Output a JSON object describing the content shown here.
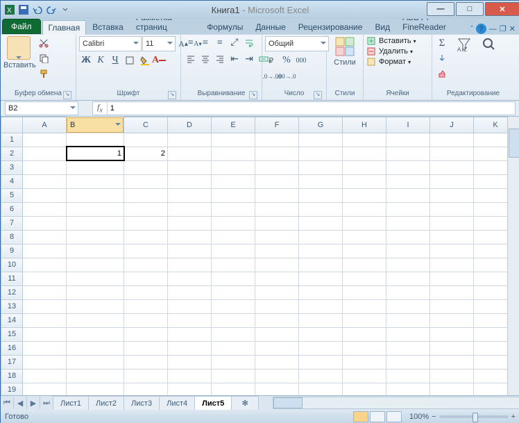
{
  "title": {
    "doc": "Книга1",
    "app": "Microsoft Excel",
    "sep": " - "
  },
  "tabs": {
    "file": "Файл",
    "home": "Главная",
    "insert": "Вставка",
    "layout": "Разметка страниц",
    "formulas": "Формулы",
    "data": "Данные",
    "review": "Рецензирование",
    "view": "Вид",
    "abbyy": "ABBYY FineReader"
  },
  "ribbon": {
    "clipboard": {
      "label": "Буфер обмена",
      "paste": "Вставить"
    },
    "font": {
      "label": "Шрифт",
      "name": "Calibri",
      "size": "11",
      "bold": "Ж",
      "italic": "К",
      "underline": "Ч"
    },
    "align": {
      "label": "Выравнивание"
    },
    "number": {
      "label": "Число",
      "format": "Общий"
    },
    "styles": {
      "label": "Стили",
      "btn": "Стили"
    },
    "cells": {
      "label": "Ячейки",
      "insert": "Вставить",
      "delete": "Удалить",
      "format": "Формат"
    },
    "edit": {
      "label": "Редактирование"
    }
  },
  "formula": {
    "cellref": "B2",
    "value": "1"
  },
  "columns": [
    "A",
    "B",
    "C",
    "D",
    "E",
    "F",
    "G",
    "H",
    "I",
    "J",
    "K"
  ],
  "rows": [
    "1",
    "2",
    "3",
    "4",
    "5",
    "6",
    "7",
    "8",
    "9",
    "10",
    "11",
    "12",
    "13",
    "14",
    "15",
    "16",
    "17",
    "18",
    "19"
  ],
  "cells": {
    "B2": "1",
    "C2": "2"
  },
  "active_cell": "B2",
  "sheets": [
    "Лист1",
    "Лист2",
    "Лист3",
    "Лист4",
    "Лист5"
  ],
  "active_sheet": "Лист5",
  "status": {
    "ready": "Готово",
    "zoom": "100%"
  }
}
